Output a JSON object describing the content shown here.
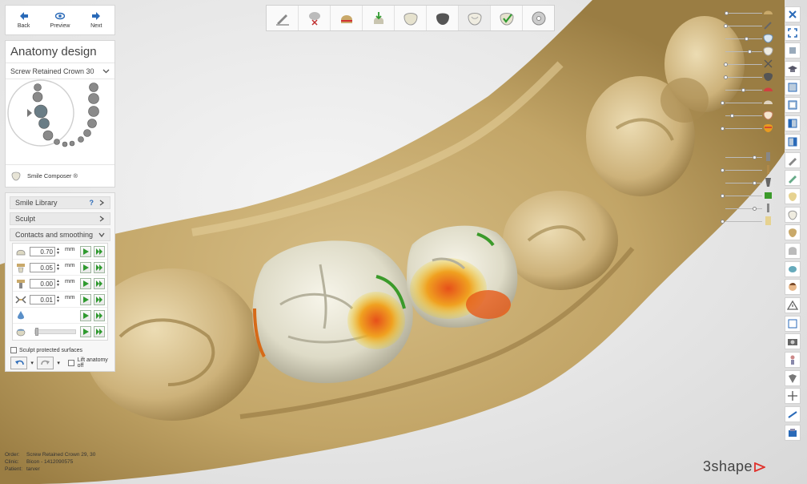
{
  "nav": {
    "back": "Back",
    "preview": "Preview",
    "next": "Next"
  },
  "panel": {
    "title": "Anatomy design",
    "crown_select": "Screw Retained Crown 30",
    "smile_composer": "Smile Composer ®"
  },
  "tools": {
    "smile_library": "Smile Library",
    "help": "?",
    "sculpt": "Sculpt",
    "contacts": "Contacts and smoothing",
    "unit": "mm",
    "rows": [
      {
        "value": "0.70",
        "icon": "occlusal-contact-icon"
      },
      {
        "value": "0.05",
        "icon": "proximal-contact-icon"
      },
      {
        "value": "0.00",
        "icon": "implant-contact-icon"
      },
      {
        "value": "0.01",
        "icon": "antagonist-contact-icon"
      }
    ],
    "sculpt_protected": "Sculpt protected surfaces",
    "lift_anatomy": "Lift anatomy off"
  },
  "toolbar": {
    "steps": [
      "edit-icon",
      "cut-icon",
      "margin-icon",
      "insertion-icon",
      "tooth-icon",
      "dark-tooth-icon",
      "anatomy-icon",
      "check-tooth-icon",
      "disc-icon"
    ],
    "active": 6
  },
  "right_toolbar": [
    "close-icon",
    "fullscreen-icon",
    "rotate-icon",
    "hat-icon",
    "view-icon",
    "view-icon",
    "view-icon",
    "view-icon",
    "pen-icon",
    "pen-icon",
    "tooth-icon",
    "tooth-icon",
    "tooth-icon",
    "tooth-icon",
    "cup-icon",
    "face-icon",
    "warning-icon",
    "box-icon",
    "camera-icon",
    "figure-icon",
    "shield-icon",
    "axis-icon",
    "ruler-icon",
    "settings-icon"
  ],
  "info": {
    "order_label": "Order:",
    "order": "Screw Retained Crown 29, 30",
    "clinic_label": "Clinic:",
    "clinic": "Bicon - 1412090575",
    "patient_label": "Patient:",
    "patient": "tarver"
  },
  "brand": "3shape",
  "colors": {
    "model": "#c8ad72",
    "crown": "#e6e3d2",
    "accent": "#2a6ab8",
    "play": "#2f9a2f"
  }
}
